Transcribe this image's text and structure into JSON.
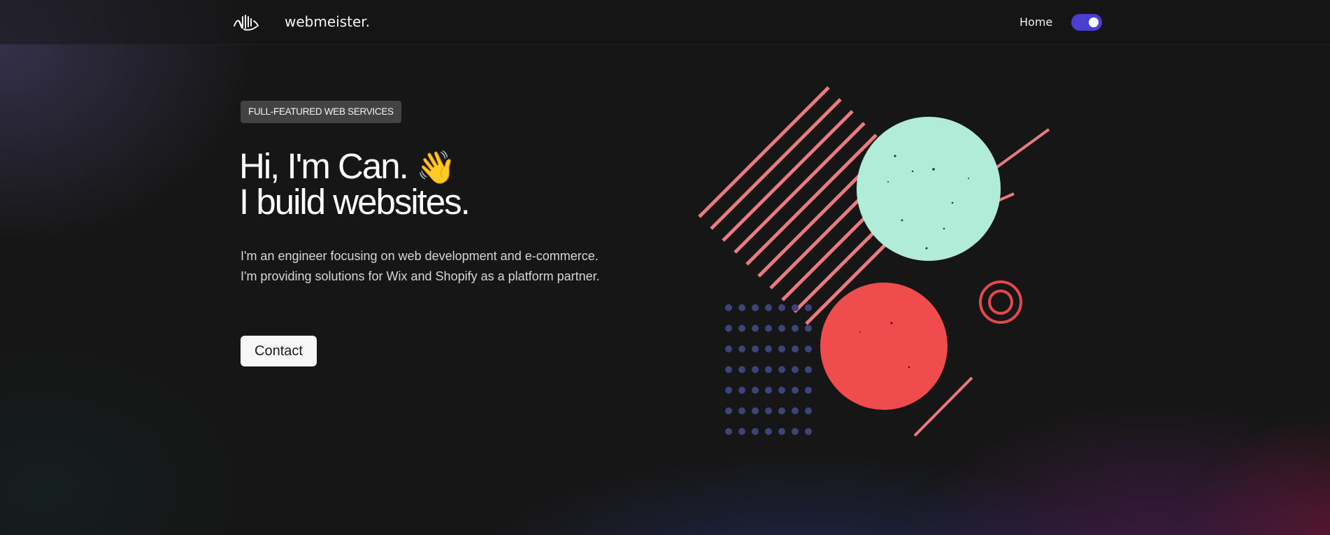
{
  "nav": {
    "logo_icon": "soundwave-hand-logo-icon",
    "brand": "webmeister.",
    "links": [
      {
        "label": "Home"
      }
    ],
    "theme_toggle": {
      "icon": "toggle-switch",
      "state": "on"
    }
  },
  "hero": {
    "badge": "FULL-FEATURED WEB SERVICES",
    "title_line1": "Hi, I'm Can.",
    "title_emoji": "👋",
    "title_line2": "I build websites.",
    "desc_line1": "I'm an engineer focusing on web development and e-commerce.",
    "desc_line2": "I'm providing solutions for Wix and Shopify as a platform partner.",
    "cta": "Contact"
  },
  "illustration": {
    "stripe_color": "#ea7a80",
    "mint_color": "#b1ecd8",
    "coral_color": "#f04b4d",
    "dot_color": "#3c447a",
    "ring_color": "#e5484d"
  },
  "colors": {
    "background": "#161616",
    "accent": "#4a3fd0",
    "badge_bg": "#434343",
    "button_bg": "#f7f7f7"
  }
}
